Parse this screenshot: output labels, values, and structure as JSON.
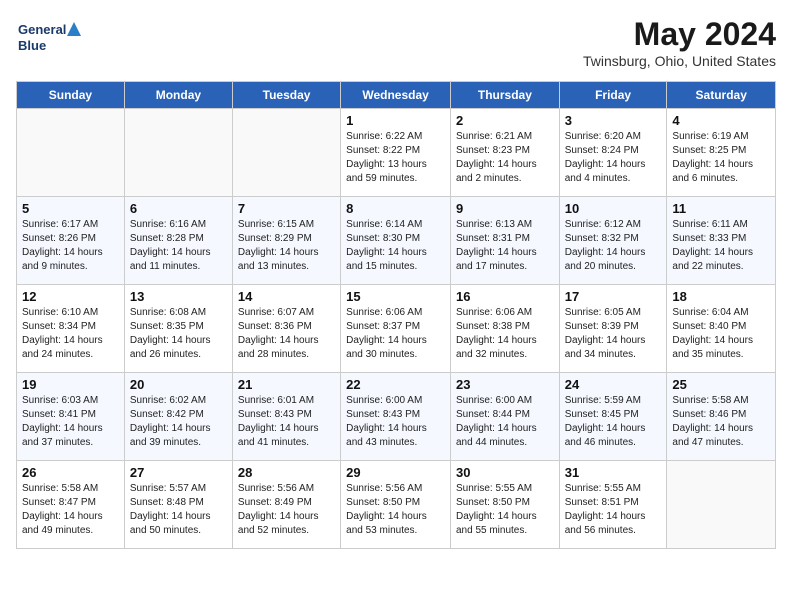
{
  "header": {
    "logo_line1": "General",
    "logo_line2": "Blue",
    "month_title": "May 2024",
    "location": "Twinsburg, Ohio, United States"
  },
  "days_of_week": [
    "Sunday",
    "Monday",
    "Tuesday",
    "Wednesday",
    "Thursday",
    "Friday",
    "Saturday"
  ],
  "weeks": [
    [
      {
        "day": "",
        "sunrise": "",
        "sunset": "",
        "daylight": ""
      },
      {
        "day": "",
        "sunrise": "",
        "sunset": "",
        "daylight": ""
      },
      {
        "day": "",
        "sunrise": "",
        "sunset": "",
        "daylight": ""
      },
      {
        "day": "1",
        "sunrise": "Sunrise: 6:22 AM",
        "sunset": "Sunset: 8:22 PM",
        "daylight": "Daylight: 13 hours and 59 minutes."
      },
      {
        "day": "2",
        "sunrise": "Sunrise: 6:21 AM",
        "sunset": "Sunset: 8:23 PM",
        "daylight": "Daylight: 14 hours and 2 minutes."
      },
      {
        "day": "3",
        "sunrise": "Sunrise: 6:20 AM",
        "sunset": "Sunset: 8:24 PM",
        "daylight": "Daylight: 14 hours and 4 minutes."
      },
      {
        "day": "4",
        "sunrise": "Sunrise: 6:19 AM",
        "sunset": "Sunset: 8:25 PM",
        "daylight": "Daylight: 14 hours and 6 minutes."
      }
    ],
    [
      {
        "day": "5",
        "sunrise": "Sunrise: 6:17 AM",
        "sunset": "Sunset: 8:26 PM",
        "daylight": "Daylight: 14 hours and 9 minutes."
      },
      {
        "day": "6",
        "sunrise": "Sunrise: 6:16 AM",
        "sunset": "Sunset: 8:28 PM",
        "daylight": "Daylight: 14 hours and 11 minutes."
      },
      {
        "day": "7",
        "sunrise": "Sunrise: 6:15 AM",
        "sunset": "Sunset: 8:29 PM",
        "daylight": "Daylight: 14 hours and 13 minutes."
      },
      {
        "day": "8",
        "sunrise": "Sunrise: 6:14 AM",
        "sunset": "Sunset: 8:30 PM",
        "daylight": "Daylight: 14 hours and 15 minutes."
      },
      {
        "day": "9",
        "sunrise": "Sunrise: 6:13 AM",
        "sunset": "Sunset: 8:31 PM",
        "daylight": "Daylight: 14 hours and 17 minutes."
      },
      {
        "day": "10",
        "sunrise": "Sunrise: 6:12 AM",
        "sunset": "Sunset: 8:32 PM",
        "daylight": "Daylight: 14 hours and 20 minutes."
      },
      {
        "day": "11",
        "sunrise": "Sunrise: 6:11 AM",
        "sunset": "Sunset: 8:33 PM",
        "daylight": "Daylight: 14 hours and 22 minutes."
      }
    ],
    [
      {
        "day": "12",
        "sunrise": "Sunrise: 6:10 AM",
        "sunset": "Sunset: 8:34 PM",
        "daylight": "Daylight: 14 hours and 24 minutes."
      },
      {
        "day": "13",
        "sunrise": "Sunrise: 6:08 AM",
        "sunset": "Sunset: 8:35 PM",
        "daylight": "Daylight: 14 hours and 26 minutes."
      },
      {
        "day": "14",
        "sunrise": "Sunrise: 6:07 AM",
        "sunset": "Sunset: 8:36 PM",
        "daylight": "Daylight: 14 hours and 28 minutes."
      },
      {
        "day": "15",
        "sunrise": "Sunrise: 6:06 AM",
        "sunset": "Sunset: 8:37 PM",
        "daylight": "Daylight: 14 hours and 30 minutes."
      },
      {
        "day": "16",
        "sunrise": "Sunrise: 6:06 AM",
        "sunset": "Sunset: 8:38 PM",
        "daylight": "Daylight: 14 hours and 32 minutes."
      },
      {
        "day": "17",
        "sunrise": "Sunrise: 6:05 AM",
        "sunset": "Sunset: 8:39 PM",
        "daylight": "Daylight: 14 hours and 34 minutes."
      },
      {
        "day": "18",
        "sunrise": "Sunrise: 6:04 AM",
        "sunset": "Sunset: 8:40 PM",
        "daylight": "Daylight: 14 hours and 35 minutes."
      }
    ],
    [
      {
        "day": "19",
        "sunrise": "Sunrise: 6:03 AM",
        "sunset": "Sunset: 8:41 PM",
        "daylight": "Daylight: 14 hours and 37 minutes."
      },
      {
        "day": "20",
        "sunrise": "Sunrise: 6:02 AM",
        "sunset": "Sunset: 8:42 PM",
        "daylight": "Daylight: 14 hours and 39 minutes."
      },
      {
        "day": "21",
        "sunrise": "Sunrise: 6:01 AM",
        "sunset": "Sunset: 8:43 PM",
        "daylight": "Daylight: 14 hours and 41 minutes."
      },
      {
        "day": "22",
        "sunrise": "Sunrise: 6:00 AM",
        "sunset": "Sunset: 8:43 PM",
        "daylight": "Daylight: 14 hours and 43 minutes."
      },
      {
        "day": "23",
        "sunrise": "Sunrise: 6:00 AM",
        "sunset": "Sunset: 8:44 PM",
        "daylight": "Daylight: 14 hours and 44 minutes."
      },
      {
        "day": "24",
        "sunrise": "Sunrise: 5:59 AM",
        "sunset": "Sunset: 8:45 PM",
        "daylight": "Daylight: 14 hours and 46 minutes."
      },
      {
        "day": "25",
        "sunrise": "Sunrise: 5:58 AM",
        "sunset": "Sunset: 8:46 PM",
        "daylight": "Daylight: 14 hours and 47 minutes."
      }
    ],
    [
      {
        "day": "26",
        "sunrise": "Sunrise: 5:58 AM",
        "sunset": "Sunset: 8:47 PM",
        "daylight": "Daylight: 14 hours and 49 minutes."
      },
      {
        "day": "27",
        "sunrise": "Sunrise: 5:57 AM",
        "sunset": "Sunset: 8:48 PM",
        "daylight": "Daylight: 14 hours and 50 minutes."
      },
      {
        "day": "28",
        "sunrise": "Sunrise: 5:56 AM",
        "sunset": "Sunset: 8:49 PM",
        "daylight": "Daylight: 14 hours and 52 minutes."
      },
      {
        "day": "29",
        "sunrise": "Sunrise: 5:56 AM",
        "sunset": "Sunset: 8:50 PM",
        "daylight": "Daylight: 14 hours and 53 minutes."
      },
      {
        "day": "30",
        "sunrise": "Sunrise: 5:55 AM",
        "sunset": "Sunset: 8:50 PM",
        "daylight": "Daylight: 14 hours and 55 minutes."
      },
      {
        "day": "31",
        "sunrise": "Sunrise: 5:55 AM",
        "sunset": "Sunset: 8:51 PM",
        "daylight": "Daylight: 14 hours and 56 minutes."
      },
      {
        "day": "",
        "sunrise": "",
        "sunset": "",
        "daylight": ""
      }
    ]
  ]
}
